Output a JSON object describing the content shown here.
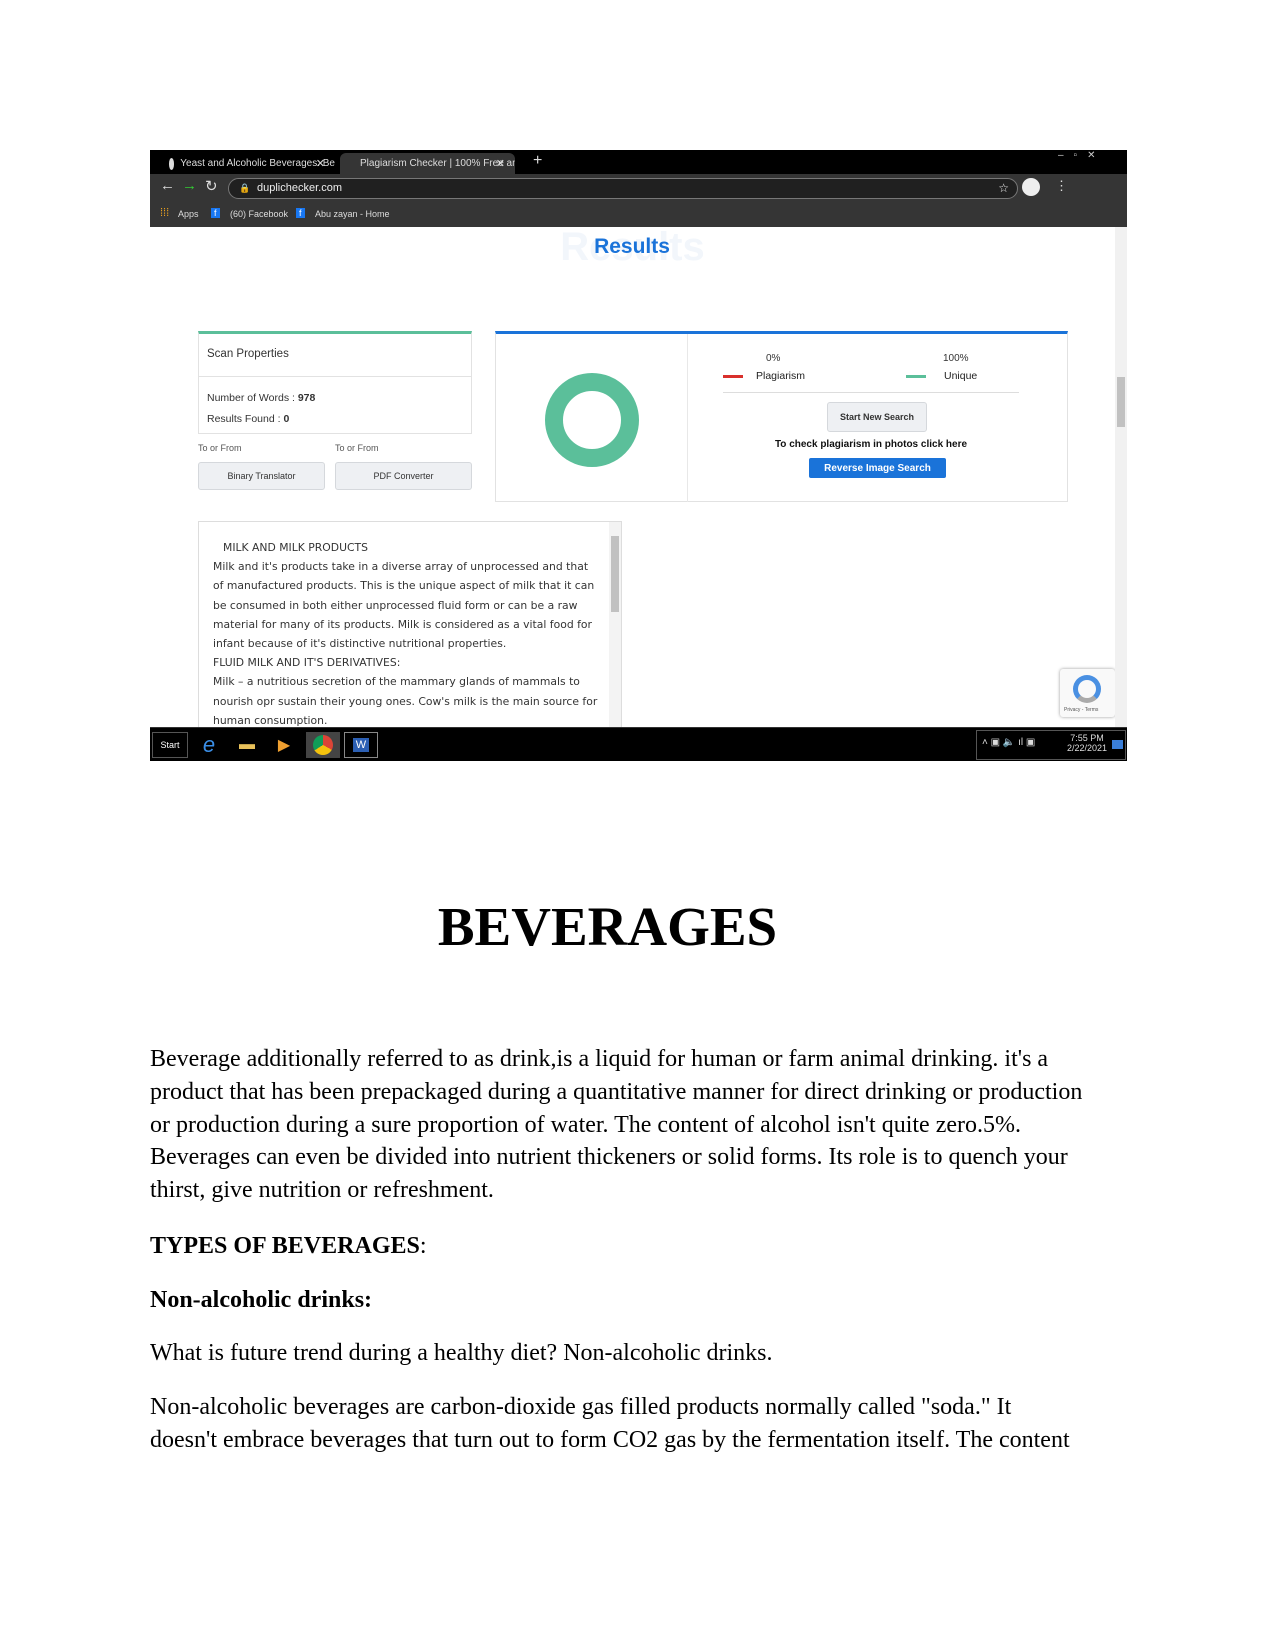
{
  "browser": {
    "tabs": [
      {
        "title": "Yeast and Alcoholic Beverages: Be",
        "active": false,
        "icon": "wordpress-icon"
      },
      {
        "title": "Plagiarism Checker | 100% Free an",
        "active": true,
        "icon": "duplichecker-icon"
      }
    ],
    "url": "duplichecker.com",
    "bookmarks": [
      "Apps",
      "(60) Facebook",
      "Abu zayan - Home"
    ]
  },
  "site": {
    "results_title": "Results",
    "scan_properties": {
      "heading": "Scan Properties",
      "words_label": "Number of Words :",
      "words_value": "978",
      "results_label": "Results Found :",
      "results_value": "0"
    },
    "converters": [
      {
        "caption": "To or From",
        "button": "Binary Translator"
      },
      {
        "caption": "To or From",
        "button": "PDF Converter"
      }
    ],
    "summary": {
      "plagiarism_pct": "0%",
      "plagiarism_label": "Plagiarism",
      "unique_pct": "100%",
      "unique_label": "Unique",
      "unique_fraction": 1.0,
      "plagiarism_color": "#d9302c",
      "unique_color": "#5bbf9a"
    },
    "start_new_search": "Start New Search",
    "photo_hint": "To check plagiarism in photos click here",
    "reverse_image_search": "Reverse Image Search",
    "text_lines": [
      "MILK AND MILK PRODUCTS",
      "Milk and it's products take in a diverse array of unprocessed and that",
      "of manufactured products. This is the unique aspect of milk that it can",
      "be consumed in both either unprocessed fluid form or can be a raw",
      "material for many of its products. Milk is considered as a vital food for",
      "infant because of it's distinctive nutritional properties.",
      "FLUID MILK AND IT'S DERIVATIVES:",
      "Milk – a nutritious secretion of the mammary glands of  mammals to",
      "nourish opr sustain their young ones. Cow's milk is the main source for",
      "human consumption."
    ],
    "recaptcha": "Privacy - Terms"
  },
  "taskbar": {
    "start": "Start",
    "time": "7:55 PM",
    "date": "2/22/2021"
  },
  "document": {
    "heading": "BEVERAGES",
    "intro": [
      "Beverage additionally referred to as drink,is a liquid for human or farm animal drinking. it's a",
      "product that has been prepackaged during a quantitative manner for direct drinking or production",
      "or production during a sure proportion of water. The content of alcohol isn't quite zero.5%.",
      "Beverages can even be divided into nutrient thickeners or solid forms. Its role is to quench your",
      "thirst, give nutrition or refreshment."
    ],
    "types_heading": "TYPES OF BEVERAGES",
    "types_colon": ":",
    "nonalc_heading": "Non-alcoholic drinks:",
    "question": "What is future trend during a healthy diet? Non-alcoholic drinks.",
    "nonalc_para": [
      "Non-alcoholic beverages are carbon-dioxide gas filled products  normally called \"soda.\" It",
      "doesn't embrace beverages that turn out to form CO2 gas by the fermentation itself. The content"
    ]
  }
}
